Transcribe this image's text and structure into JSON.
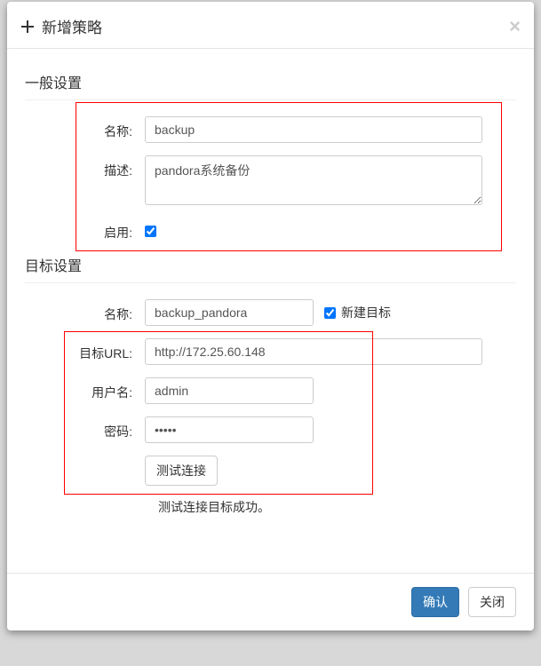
{
  "header": {
    "title": "新增策略",
    "close": "×"
  },
  "sections": {
    "general": "一般设置",
    "target": "目标设置"
  },
  "labels": {
    "name": "名称:",
    "description": "描述:",
    "enable": "启用:",
    "target_name": "名称:",
    "target_url": "目标URL:",
    "username": "用户名:",
    "password": "密码:",
    "new_target": "新建目标"
  },
  "values": {
    "name": "backup",
    "description": "pandora系统备份",
    "enable": true,
    "target_name": "backup_pandora",
    "new_target": true,
    "target_url": "http://172.25.60.148",
    "username": "admin",
    "password": "•••••"
  },
  "buttons": {
    "test": "测试连接",
    "confirm": "确认",
    "close": "关闭"
  },
  "status": "测试连接目标成功。"
}
